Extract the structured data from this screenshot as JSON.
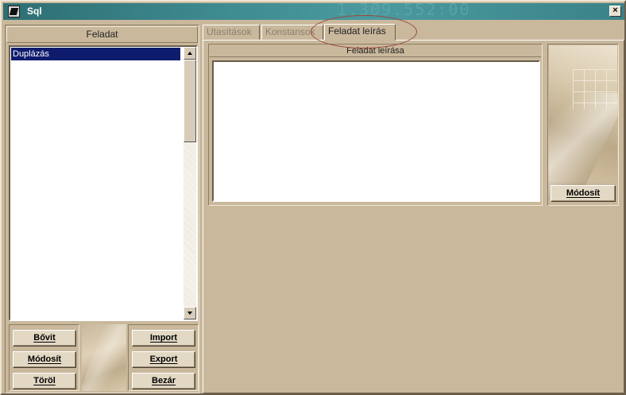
{
  "window": {
    "title": "Sql",
    "title_ghost": "1.309.552:00",
    "close_glyph": "×"
  },
  "left": {
    "header": "Feladat",
    "list_items": [
      "Duplázás"
    ],
    "buttons": {
      "bovit": "Bővit",
      "modosit": "Módosít",
      "torol": "Töröl",
      "import": "Import",
      "export": "Export",
      "bezar": "Bezár"
    }
  },
  "tabs": [
    {
      "label": "Utasítások",
      "active": false
    },
    {
      "label": "Konstansok",
      "active": false
    },
    {
      "label": "Feladat leírás",
      "active": true
    }
  ],
  "description": {
    "title": "Feladat leírása",
    "value": "",
    "modify_button": "Módosít"
  },
  "colors": {
    "background": "#c9b89c",
    "titlebar": "#3e8b90",
    "selection": "#0f1c6e",
    "highlight_ellipse": "#9b4a3a"
  },
  "icons": [
    "app-icon",
    "close-icon",
    "scroll-up-icon",
    "scroll-down-icon"
  ]
}
